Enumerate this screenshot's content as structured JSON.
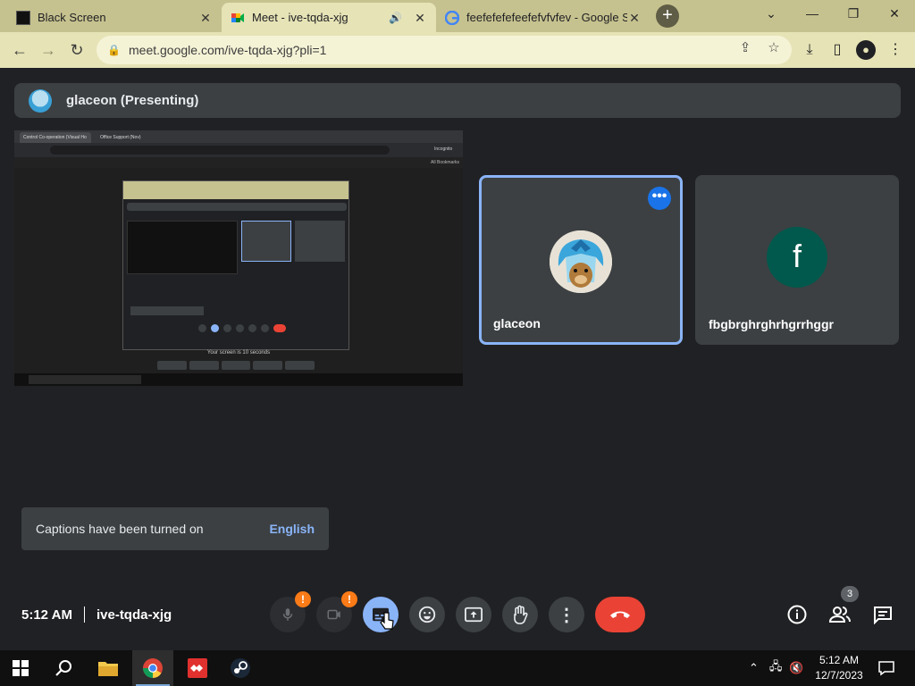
{
  "browser": {
    "tabs": [
      {
        "title": "Black Screen",
        "active": false
      },
      {
        "title": "Meet - ive-tqda-xjg",
        "active": true
      },
      {
        "title": "feefefefefeefefvfvfev - Google Se",
        "active": false
      }
    ],
    "url": "meet.google.com/ive-tqda-xjg?pli=1"
  },
  "meet": {
    "presenter_label": "glaceon (Presenting)",
    "participants": [
      {
        "name": "glaceon",
        "avatar": "glaceon-avatar",
        "active": true
      },
      {
        "name": "fbgbrghrghrhgrrhggr",
        "initial": "f",
        "avatar_color": "#00594c"
      }
    ],
    "captions_toast": {
      "message": "Captions have been turned on",
      "action": "English"
    },
    "time": "5:12 AM",
    "meeting_code": "ive-tqda-xjg",
    "participant_count": "3",
    "mic_badge": "!",
    "cam_badge": "!"
  },
  "shared_screen": {
    "tab1": "Control Co-operation (Visual Ho",
    "tab2": "Office Support (Nov)",
    "profile": "Incognito",
    "bookmarks": "All Bookmarks",
    "caption": "Your screen is 10 seconds"
  },
  "taskbar": {
    "time": "5:12 AM",
    "date": "12/7/2023"
  },
  "colors": {
    "meet_bg": "#202124",
    "tile": "#3c4043",
    "accent": "#8ab4f8",
    "end_call": "#ea4335",
    "chrome_theme": "#c6c28f"
  }
}
